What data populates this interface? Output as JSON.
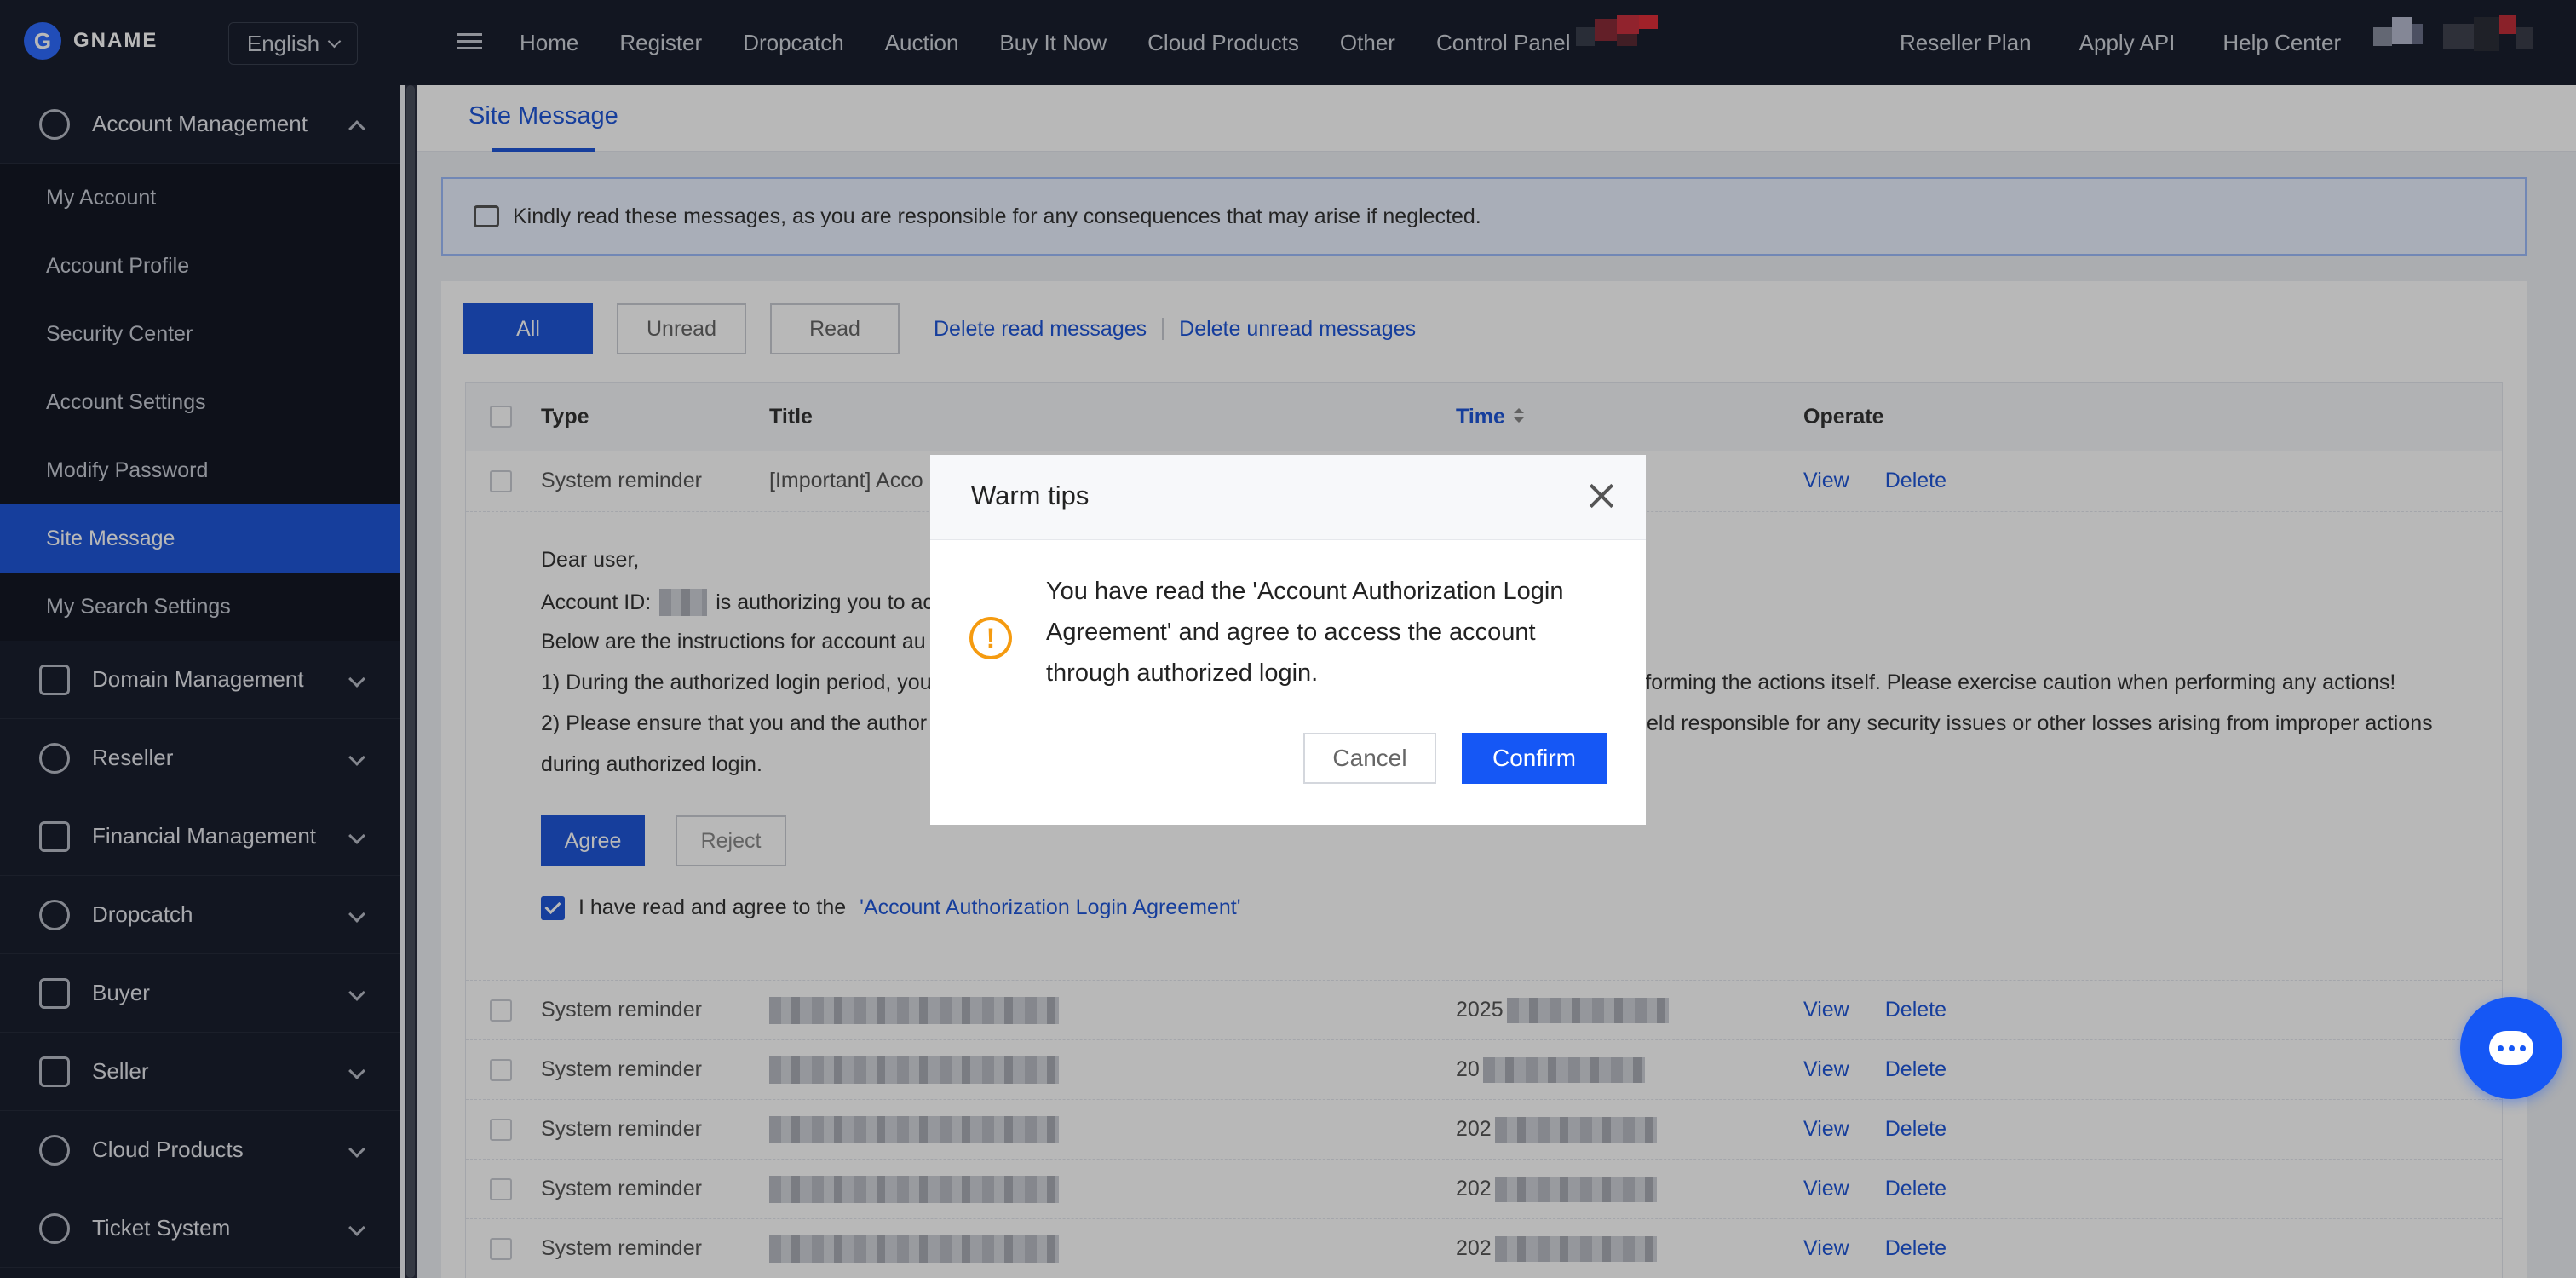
{
  "brand": {
    "name": "GNAME"
  },
  "language": "English",
  "nav": {
    "links": [
      "Home",
      "Register",
      "Dropcatch",
      "Auction",
      "Buy It Now",
      "Cloud Products",
      "Other",
      "Control Panel"
    ],
    "right": [
      "Reseller Plan",
      "Apply API",
      "Help Center"
    ]
  },
  "sidebar": {
    "account_group": "Account Management",
    "account_items": [
      "My Account",
      "Account Profile",
      "Security Center",
      "Account Settings",
      "Modify Password",
      "Site Message",
      "My Search Settings"
    ],
    "active_item": "Site Message",
    "groups": [
      "Domain Management",
      "Reseller",
      "Financial Management",
      "Dropcatch",
      "Buyer",
      "Seller",
      "Cloud Products",
      "Ticket System"
    ]
  },
  "page": {
    "tab": "Site Message",
    "notice": "Kindly read these messages, as you are responsible for any consequences that may arise if neglected."
  },
  "filters": {
    "all": "All",
    "unread": "Unread",
    "read": "Read",
    "delete_read": "Delete read messages",
    "delete_unread": "Delete unread messages"
  },
  "table": {
    "headers": {
      "type": "Type",
      "title": "Title",
      "time": "Time",
      "operate": "Operate"
    },
    "first_row": {
      "type": "System reminder",
      "title": "[Important] Acco"
    },
    "rows": [
      {
        "type": "System reminder",
        "time_prefix": "2025"
      },
      {
        "type": "System reminder",
        "time_prefix": "20"
      },
      {
        "type": "System reminder",
        "time_prefix": "202"
      },
      {
        "type": "System reminder",
        "time_prefix": "202"
      },
      {
        "type": "System reminder",
        "time_prefix": "202"
      }
    ],
    "view": "View",
    "delete": "Delete"
  },
  "detail": {
    "greeting": "Dear user,",
    "account_id_label": "Account ID:",
    "account_id_tail": "is authorizing you to ac",
    "instructions": "Below are the instructions for account au",
    "point1_start": "1) During the authorized login period, you",
    "point1_end": "rforming the actions itself. Please exercise caution when performing any actions!",
    "point2_start": "2) Please ensure that you and the author",
    "point2_end": "eld responsible for any security issues or other losses arising from improper actions",
    "point2_line2": "during authorized login.",
    "agree": "Agree",
    "reject": "Reject",
    "agree_text": "I have read and agree to the",
    "agree_link": "'Account Authorization Login Agreement'"
  },
  "modal": {
    "title": "Warm tips",
    "message": "You have read the 'Account Authorization Login Agreement' and agree to access the account through authorized login.",
    "cancel": "Cancel",
    "confirm": "Confirm",
    "icon_text": "!"
  },
  "colors": {
    "primary": "#1f56d8",
    "confirm": "#1557f5",
    "warning": "#f59b10",
    "sidebar": "#1a1f2e"
  },
  "icons": {
    "chat": "chat-icon",
    "warning": "warning-icon",
    "close": "close-icon",
    "speaker": "speaker-icon"
  }
}
